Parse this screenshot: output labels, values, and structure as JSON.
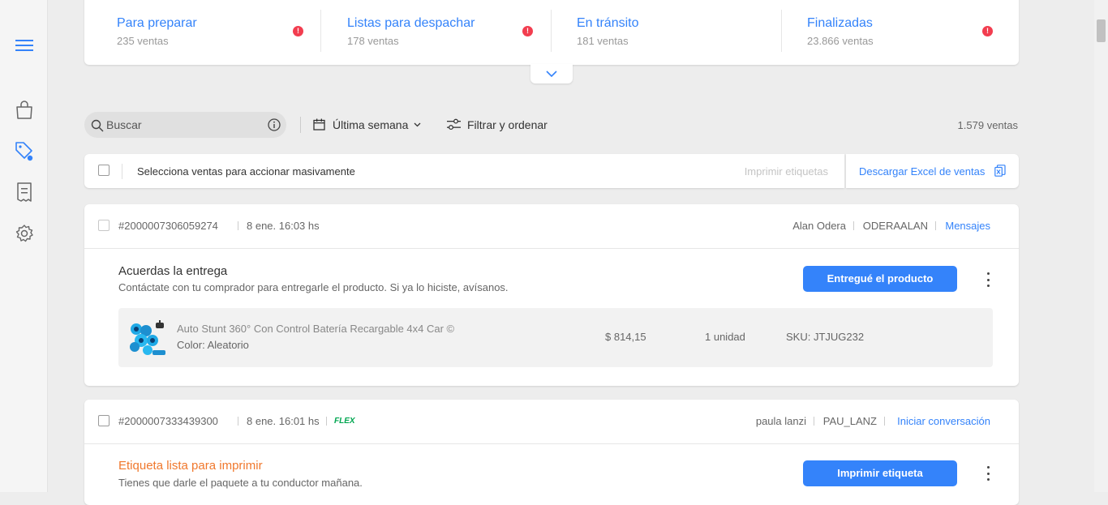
{
  "sidebar": {
    "icons": [
      "menu-icon",
      "shopping-bag-icon",
      "price-tag-icon",
      "receipt-icon",
      "settings-icon"
    ],
    "active_color": "#3483fa"
  },
  "statuses": [
    {
      "title": "Para preparar",
      "count": "235 ventas"
    },
    {
      "title": "Listas para despachar",
      "count": "178 ventas"
    },
    {
      "title": "En tránsito",
      "count": "181 ventas"
    },
    {
      "title": "Finalizadas",
      "count": "23.866 ventas"
    }
  ],
  "alert_glyph": "!",
  "toolbar": {
    "search_placeholder": "Buscar",
    "date_filter": "Última semana",
    "filter_label": "Filtrar y ordenar",
    "total": "1.579 ventas"
  },
  "bulk": {
    "label": "Selecciona ventas para accionar masivamente",
    "print_labels": "Imprimir etiquetas",
    "download_excel": "Descargar Excel de ventas"
  },
  "orders": [
    {
      "id": "#2000007306059274",
      "date": "8 ene. 16:03 hs",
      "buyer": "Alan Odera",
      "nickname": "ODERAALAN",
      "contact": "Mensajes",
      "status_title": "Acuerdas la entrega",
      "status_desc": "Contáctate con tu comprador para entregarle el producto. Si ya lo hiciste, avísanos.",
      "action": "Entregué el producto",
      "product": {
        "name": "Auto Stunt 360° Con Control Batería Recargable 4x4 Car ©",
        "variant": "Color: Aleatorio",
        "price": "$ 814,15",
        "quantity": "1 unidad",
        "sku": "SKU: JTJUG232"
      }
    },
    {
      "id": "#2000007333439300",
      "date": "8 ene. 16:01 hs",
      "shipping_badge": "FLEX",
      "buyer": "paula lanzi",
      "nickname": "PAU_LANZ",
      "contact": "Iniciar conversación",
      "status_title": "Etiqueta lista para imprimir",
      "status_desc": "Tienes que darle el paquete a tu conductor mañana.",
      "action": "Imprimir etiqueta"
    }
  ],
  "colors": {
    "accent": "#3483fa",
    "alert": "#f23d4f",
    "warning_title": "#f0782d",
    "flex_badge": "#00a650"
  }
}
